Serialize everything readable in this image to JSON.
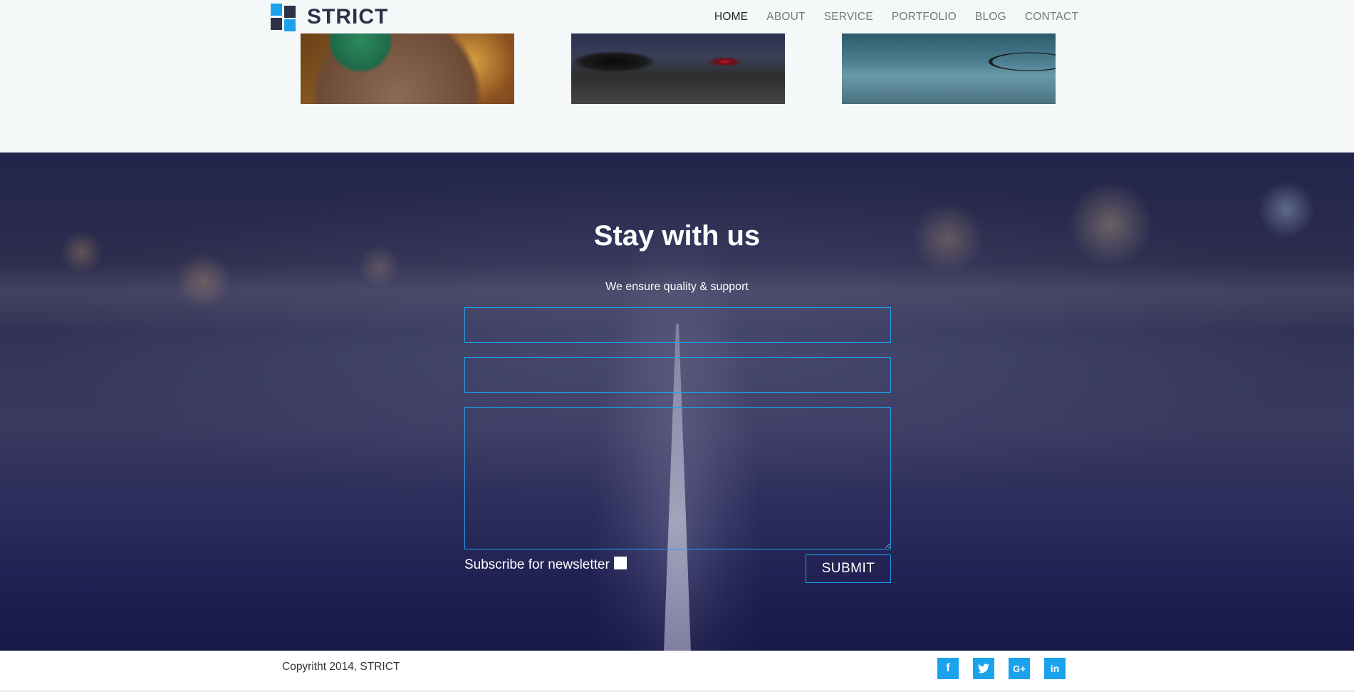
{
  "header": {
    "logo_text": "STRICT",
    "nav": [
      "HOME",
      "ABOUT",
      "SERVICE",
      "PORTFOLIO",
      "BLOG",
      "CONTACT"
    ],
    "active_nav": "HOME"
  },
  "portfolio": {
    "thumbnails": [
      "coffee-cup-image",
      "bicycle-rack-image",
      "bicycle-wheel-image"
    ]
  },
  "contact": {
    "title": "Stay with us",
    "subtitle": "We ensure quality & support",
    "name_value": "",
    "email_value": "",
    "message_value": "",
    "subscribe_label": "Subscribe for newsletter",
    "subscribe_checked": false,
    "submit_label": "SUBMIT"
  },
  "footer": {
    "copyright": "Copyritht 2014, STRICT",
    "social": [
      {
        "icon": "facebook-icon",
        "glyph": "f"
      },
      {
        "icon": "twitter-icon",
        "glyph": "t"
      },
      {
        "icon": "google-plus-icon",
        "glyph": "G+"
      },
      {
        "icon": "linkedin-icon",
        "glyph": "in"
      }
    ]
  },
  "colors": {
    "accent": "#1aa3ec",
    "logo_dark": "#2c3348",
    "background": "#f5f8f9"
  }
}
